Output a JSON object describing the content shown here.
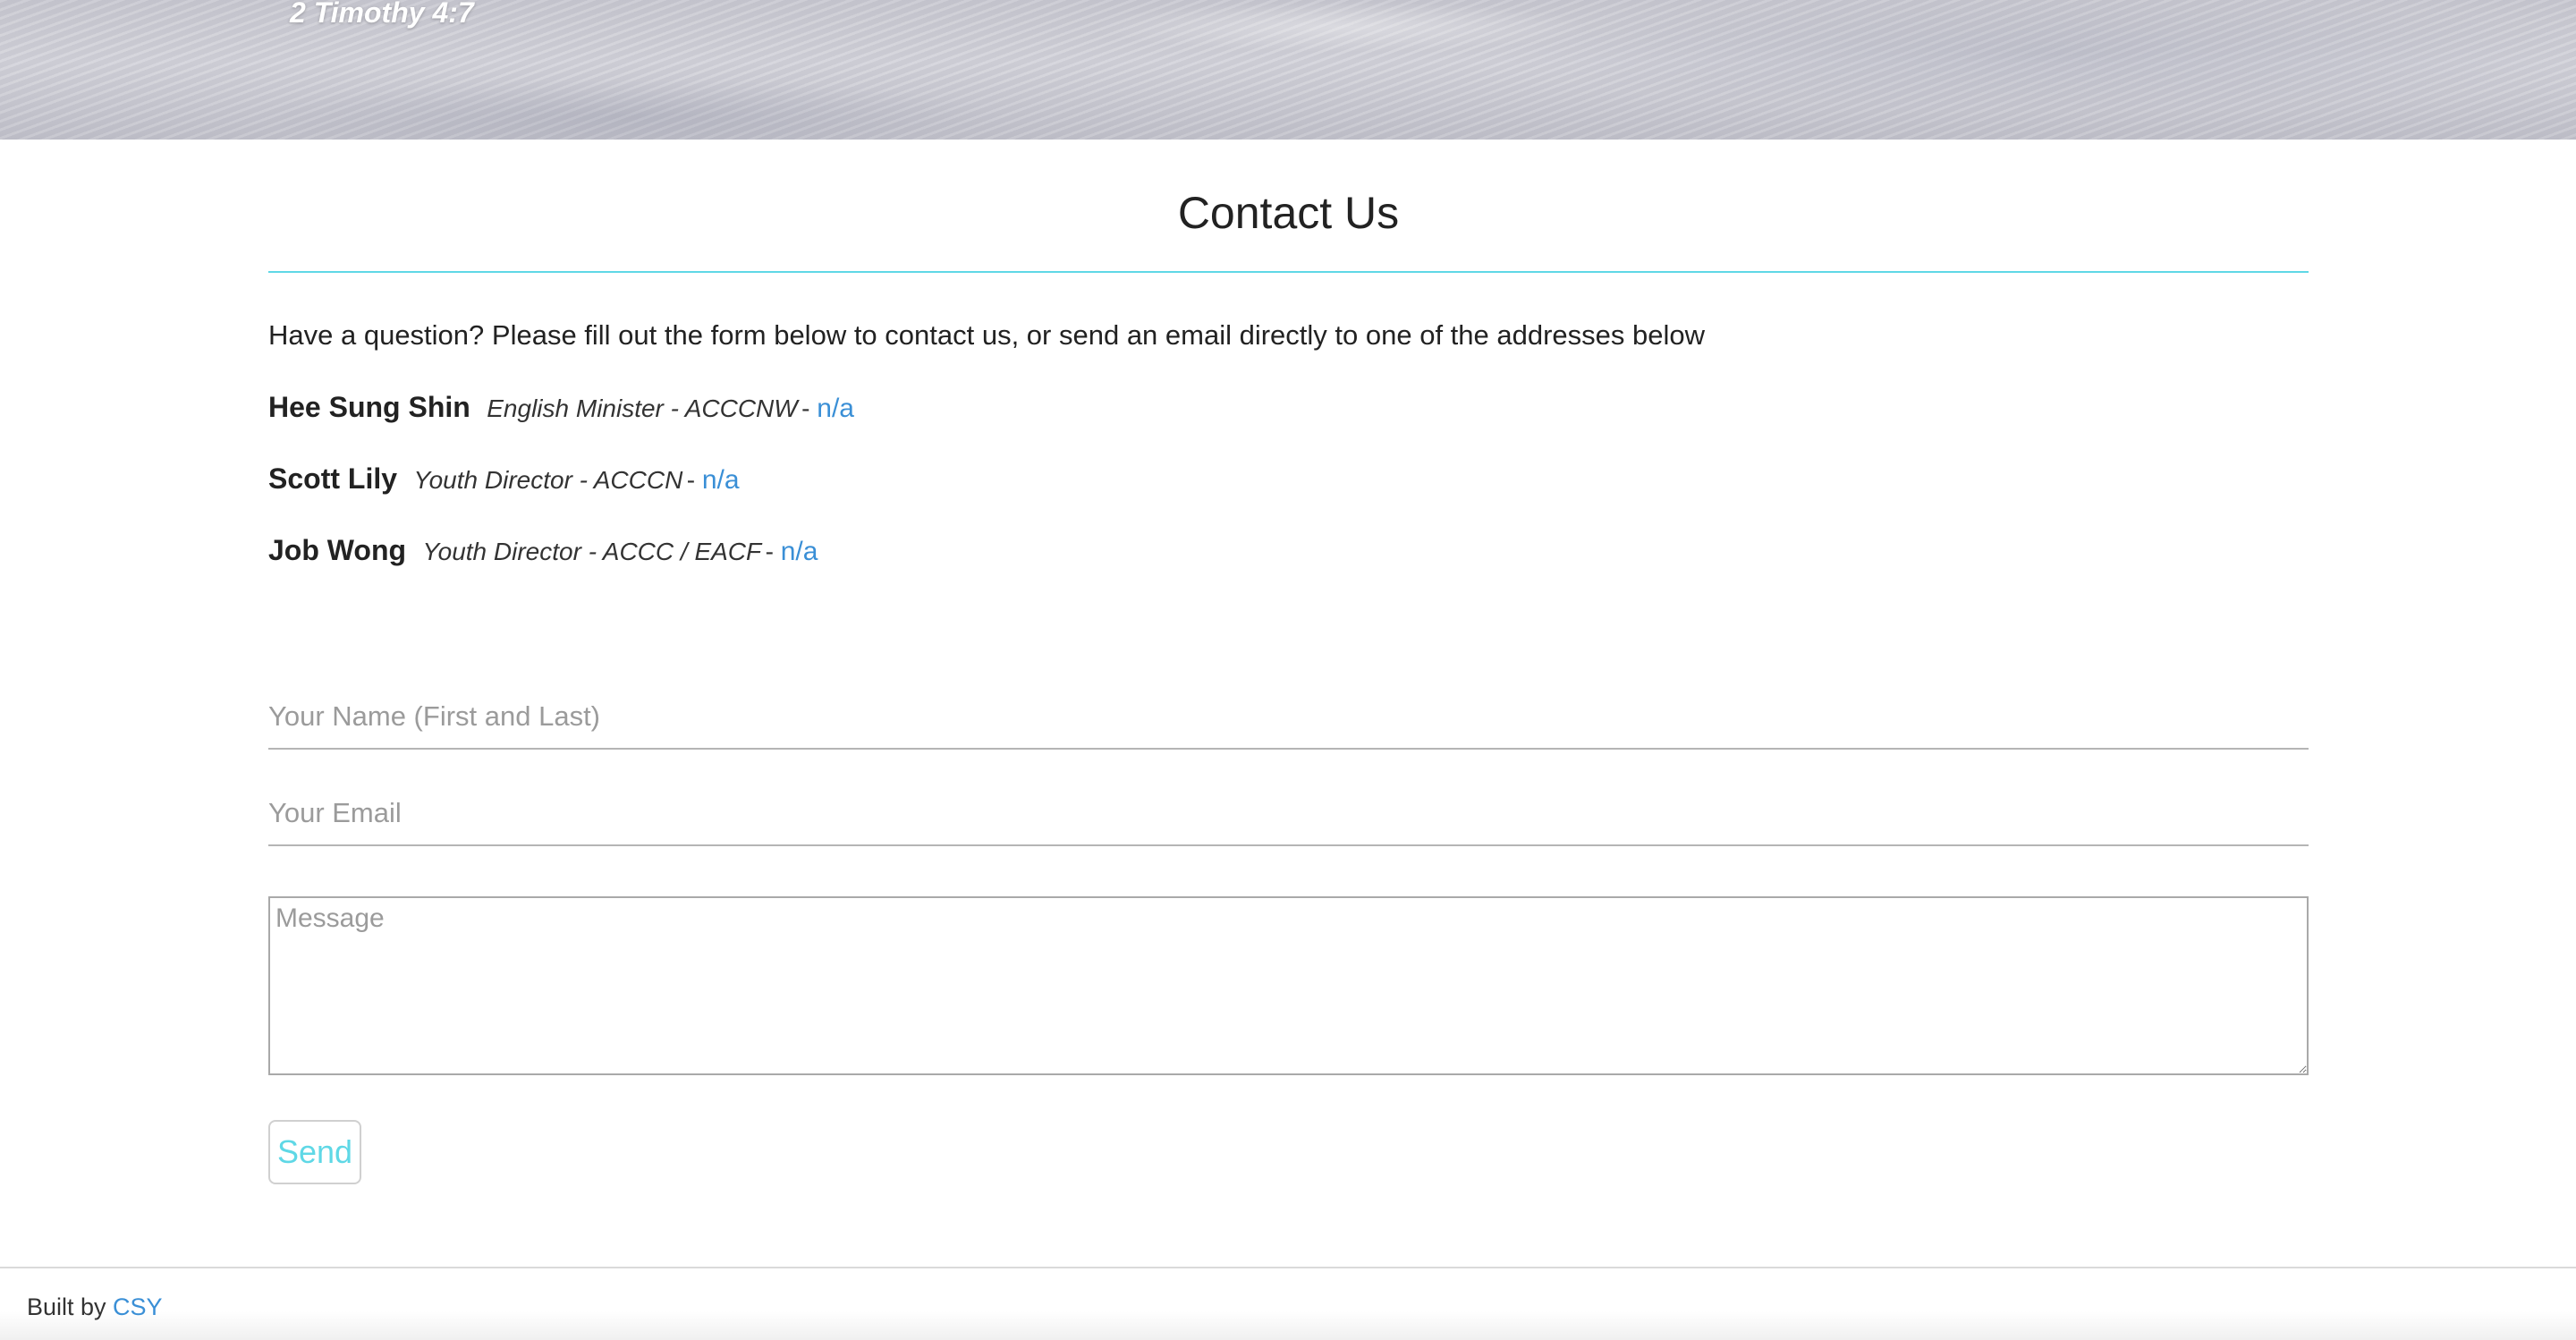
{
  "hero": {
    "verse": "2 Timothy 4:7"
  },
  "contact_section": {
    "title": "Contact Us",
    "intro": "Have a question? Please fill out the form below to contact us, or send an email directly to one of the addresses below",
    "separator": " - ",
    "contacts": [
      {
        "name": "Hee Sung Shin",
        "role": "English Minister - ACCCNW",
        "email": "n/a"
      },
      {
        "name": "Scott Lily",
        "role": "Youth Director - ACCCN",
        "email": "n/a"
      },
      {
        "name": "Job Wong",
        "role": "Youth Director - ACCC / EACF",
        "email": "n/a"
      }
    ]
  },
  "form": {
    "name_placeholder": "Your Name (First and Last)",
    "name_value": "",
    "email_placeholder": "Your Email",
    "email_value": "",
    "message_placeholder": "Message",
    "message_value": "",
    "send_label": "Send"
  },
  "footer": {
    "built_by_label": "Built by ",
    "built_by_link": "CSY"
  },
  "colors": {
    "accent_cyan": "#5fd8e6",
    "link_blue": "#3a8fd6"
  }
}
